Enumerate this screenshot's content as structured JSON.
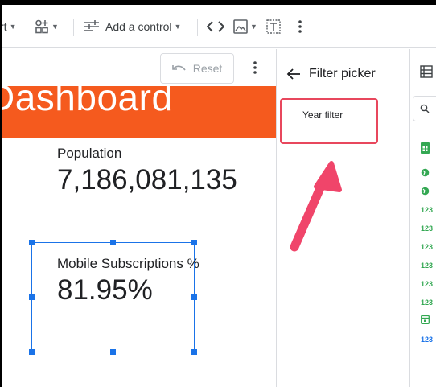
{
  "toolbar": {
    "insert_chart_partial": "rt",
    "add_control_label": "Add a control"
  },
  "canvas": {
    "reset_label": "Reset",
    "banner_title": "Dashboard",
    "scorecards": [
      {
        "label": "Population",
        "value": "7,186,081,135"
      },
      {
        "label": "Mobile Subscriptions %",
        "value": "81.95%"
      }
    ]
  },
  "filter_panel": {
    "title": "Filter picker",
    "filters": [
      {
        "label": "Year filter"
      }
    ]
  },
  "data_panel": {
    "field_types": [
      "geo",
      "geo",
      "123",
      "123",
      "123",
      "123",
      "123",
      "123",
      "date",
      "123"
    ]
  },
  "colors": {
    "banner": "#f55a1e",
    "selection": "#1a73e8",
    "highlight": "#e8475d",
    "numeric_field": "#34a853",
    "metric_field": "#1a73e8"
  }
}
